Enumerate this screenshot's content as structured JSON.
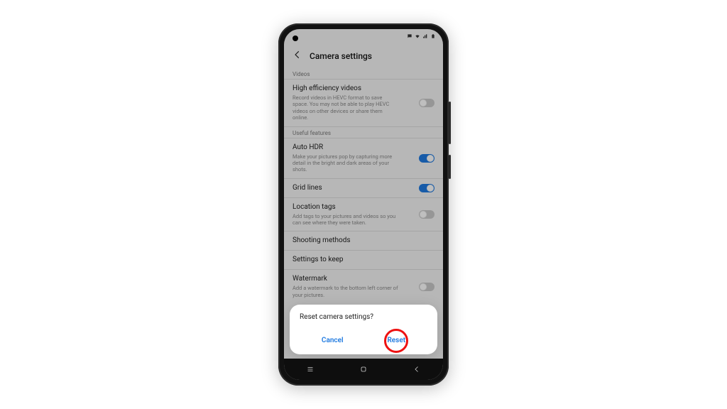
{
  "status": {
    "icons": [
      "chat-icon",
      "wifi-icon",
      "signal-icon",
      "battery-icon"
    ]
  },
  "header": {
    "title": "Camera settings"
  },
  "sections": {
    "videos_label": "Videos",
    "useful_label": "Useful features"
  },
  "rows": {
    "hev": {
      "title": "High efficiency videos",
      "desc": "Record videos in HEVC format to save space. You may not be able to play HEVC videos on other devices or share them online.",
      "on": false
    },
    "hdr": {
      "title": "Auto HDR",
      "desc": "Make your pictures pop by capturing more detail in the bright and dark areas of your shots.",
      "on": true
    },
    "grid": {
      "title": "Grid lines",
      "on": true
    },
    "loc": {
      "title": "Location tags",
      "desc": "Add tags to your pictures and videos so you can see where they were taken.",
      "on": false
    },
    "shoot": {
      "title": "Shooting methods"
    },
    "keep": {
      "title": "Settings to keep"
    },
    "wm": {
      "title": "Watermark",
      "desc": "Add a watermark to the bottom left corner of your pictures.",
      "on": false
    }
  },
  "dialog": {
    "message": "Reset camera settings?",
    "cancel": "Cancel",
    "reset": "Reset"
  }
}
